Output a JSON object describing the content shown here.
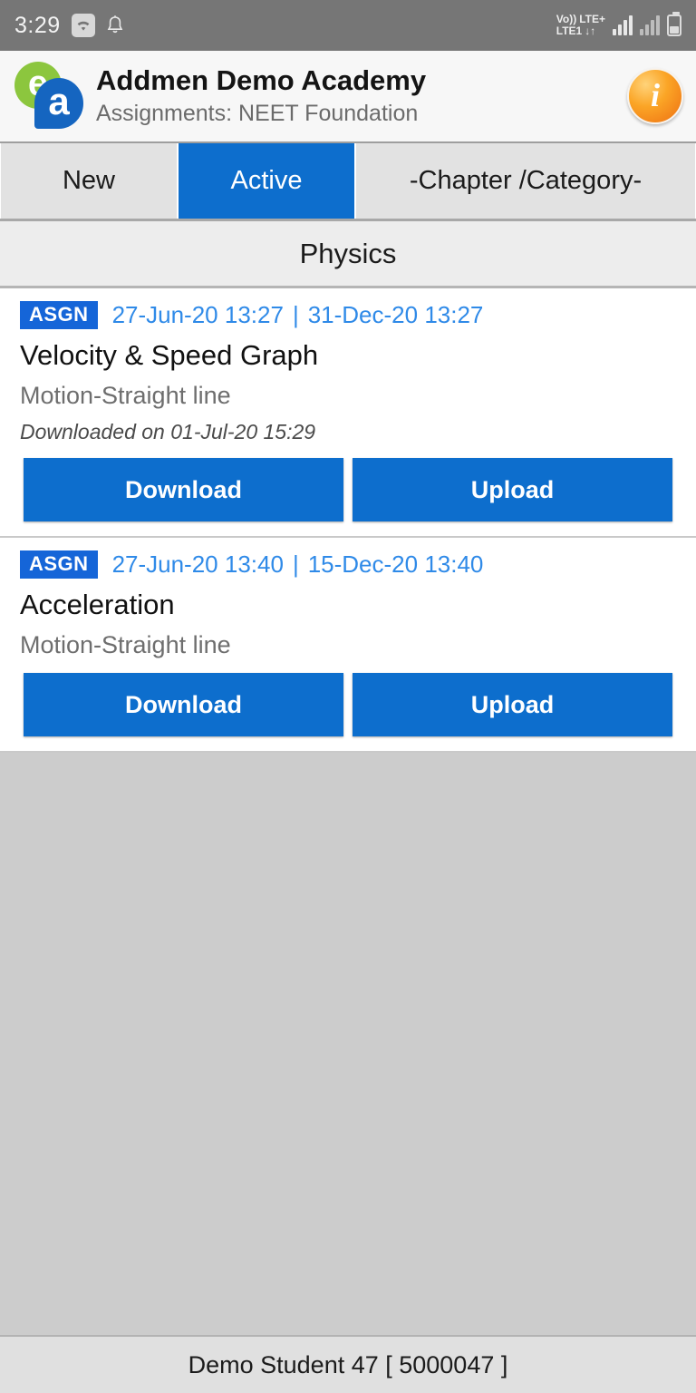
{
  "statusbar": {
    "time": "3:29",
    "wifi_icon": "wifi-icon",
    "bell_icon": "notification-bell-icon",
    "volte_label": "Vo))",
    "lte_plus_label": "LTE+",
    "lte1_label": "LTE1",
    "data_arrows": "↓↑",
    "background_color": "#767676"
  },
  "header": {
    "logo_e": "e",
    "logo_a": "a",
    "title": "Addmen Demo Academy",
    "subtitle": "Assignments: NEET Foundation",
    "info_glyph": "i"
  },
  "tabs": {
    "items": [
      {
        "label": "New",
        "selected": false
      },
      {
        "label": "Active",
        "selected": true
      },
      {
        "label": "-Chapter /Category-",
        "selected": false
      }
    ],
    "active_color": "#0d6ecd"
  },
  "subject": {
    "label": "Physics"
  },
  "assignments": [
    {
      "badge": "ASGN",
      "start_date": "27-Jun-20 13:27",
      "separator": "|",
      "end_date": "31-Dec-20 13:27",
      "title": "Velocity & Speed Graph",
      "chapter": "Motion-Straight line",
      "note": "Downloaded on 01-Jul-20 15:29",
      "download_label": "Download",
      "upload_label": "Upload"
    },
    {
      "badge": "ASGN",
      "start_date": "27-Jun-20 13:40",
      "separator": "|",
      "end_date": "15-Dec-20 13:40",
      "title": "Acceleration",
      "chapter": "Motion-Straight line",
      "note": "",
      "download_label": "Download",
      "upload_label": "Upload"
    }
  ],
  "footer": {
    "label": "Demo Student 47 [ 5000047 ]"
  }
}
